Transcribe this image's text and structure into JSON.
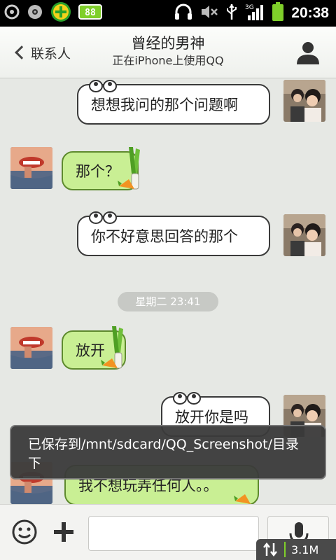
{
  "status_bar": {
    "time": "20:38",
    "icons": [
      "sync-icon",
      "media-icon",
      "qq-manager-icon",
      "battery-widget-icon",
      "headset-icon",
      "mute-icon",
      "usb-icon",
      "3g-signal-icon",
      "battery-icon"
    ]
  },
  "header": {
    "back_label": "联系人",
    "title": "曾经的男神",
    "subtitle": "正在iPhone上使用QQ"
  },
  "messages": [
    {
      "side": "right",
      "text": "想想我问的那个问题啊",
      "style": "white"
    },
    {
      "side": "left",
      "text": "那个？",
      "style": "green"
    },
    {
      "side": "right",
      "text": "你不好意思回答的那个",
      "style": "white"
    },
    {
      "side": "left",
      "text": "放开",
      "style": "green"
    },
    {
      "side": "right",
      "text": "放开你是吗",
      "style": "white"
    },
    {
      "side": "left",
      "text": "我不想玩弄任何人。。",
      "style": "green"
    }
  ],
  "timestamp": "星期二 23:41",
  "toast": "已保存到/mnt/sdcard/QQ_Screenshot/目录下",
  "input_bar": {
    "placeholder": "",
    "net_speed": "3.1M"
  },
  "colors": {
    "green_bubble": "#c9ef94",
    "white_bubble": "#ffffff",
    "background": "#e6e8e4"
  }
}
